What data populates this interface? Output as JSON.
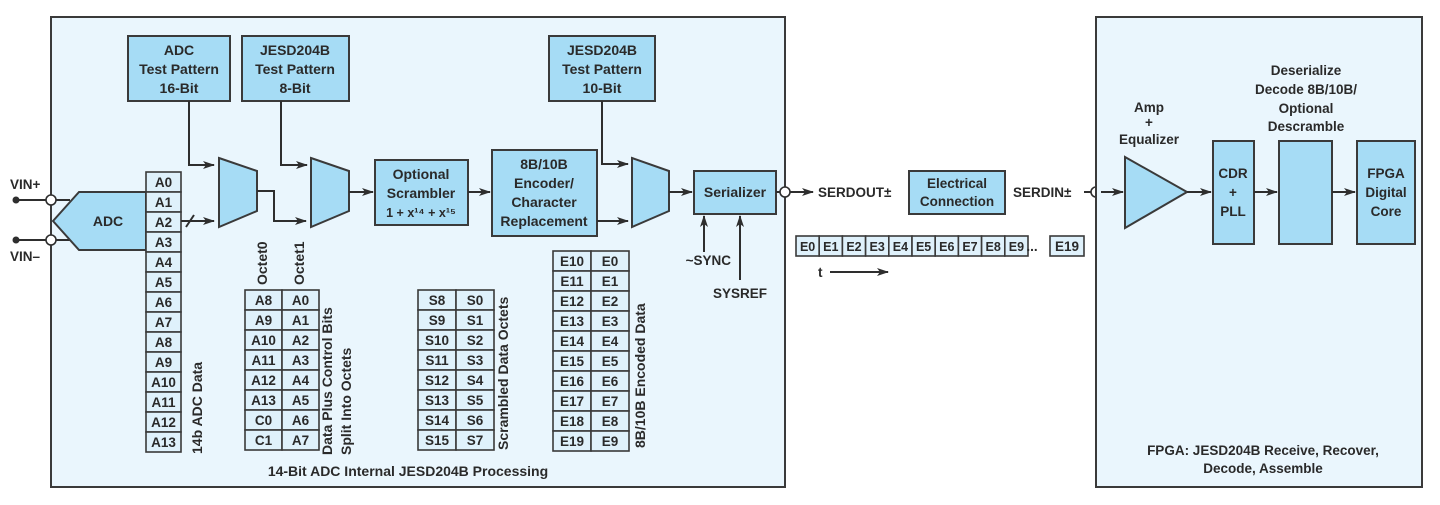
{
  "adc_panel": {
    "caption": "14-Bit ADC Internal JESD204B Processing",
    "inputs": [
      "VIN+",
      "VIN–"
    ],
    "adc_label": "ADC",
    "adc_test_pattern": [
      "ADC",
      "Test Pattern",
      "16-Bit"
    ],
    "jesd_test_pattern_8": [
      "JESD204B",
      "Test Pattern",
      "8-Bit"
    ],
    "jesd_test_pattern_10": [
      "JESD204B",
      "Test Pattern",
      "10-Bit"
    ],
    "scrambler": [
      "Optional",
      "Scrambler",
      "1 + x¹⁴ + x¹⁵"
    ],
    "encoder": [
      "8B/10B",
      "Encoder/",
      "Character",
      "Replacement"
    ],
    "serializer": "Serializer",
    "sync_label": "~SYNC",
    "sysref_label": "SYSREF",
    "octet_labels": [
      "Octet0",
      "Octet1"
    ],
    "adc_data": {
      "label": "14b ADC Data",
      "cells": [
        "A0",
        "A1",
        "A2",
        "A3",
        "A4",
        "A5",
        "A6",
        "A7",
        "A8",
        "A9",
        "A10",
        "A11",
        "A12",
        "A13"
      ]
    },
    "octets_table": {
      "label_lines": [
        "Data Plus Control Bits",
        "Split Into Octets"
      ],
      "rows": [
        [
          "A8",
          "A0"
        ],
        [
          "A9",
          "A1"
        ],
        [
          "A10",
          "A2"
        ],
        [
          "A11",
          "A3"
        ],
        [
          "A12",
          "A4"
        ],
        [
          "A13",
          "A5"
        ],
        [
          "C0",
          "A6"
        ],
        [
          "C1",
          "A7"
        ]
      ]
    },
    "scrambled_table": {
      "label": "Scrambled Data Octets",
      "rows": [
        [
          "S8",
          "S0"
        ],
        [
          "S9",
          "S1"
        ],
        [
          "S10",
          "S2"
        ],
        [
          "S11",
          "S3"
        ],
        [
          "S12",
          "S4"
        ],
        [
          "S13",
          "S5"
        ],
        [
          "S14",
          "S6"
        ],
        [
          "S15",
          "S7"
        ]
      ]
    },
    "encoded_table": {
      "label": "8B/10B Encoded Data",
      "rows": [
        [
          "E10",
          "E0"
        ],
        [
          "E11",
          "E1"
        ],
        [
          "E12",
          "E2"
        ],
        [
          "E13",
          "E3"
        ],
        [
          "E14",
          "E4"
        ],
        [
          "E15",
          "E5"
        ],
        [
          "E16",
          "E6"
        ],
        [
          "E17",
          "E7"
        ],
        [
          "E18",
          "E8"
        ],
        [
          "E19",
          "E9"
        ]
      ]
    }
  },
  "link": {
    "serdout": "SERDOUT±",
    "serdin": "SERDIN±",
    "connection": [
      "Electrical",
      "Connection"
    ],
    "stream": [
      "E0",
      "E1",
      "E2",
      "E3",
      "E4",
      "E5",
      "E6",
      "E7",
      "E8",
      "E9"
    ],
    "ellipsis": "...",
    "stream_last": "E19",
    "time_label": "t"
  },
  "fpga_panel": {
    "caption": [
      "FPGA: JESD204B Receive, Recover,",
      "Decode, Assemble"
    ],
    "amp_label": [
      "Amp",
      "+",
      "Equalizer"
    ],
    "cdr": [
      "CDR",
      "+",
      "PLL"
    ],
    "deserialize_label": [
      "Deserialize",
      "Decode 8B/10B/",
      "Optional",
      "Descramble"
    ],
    "core": [
      "FPGA",
      "Digital",
      "Core"
    ]
  },
  "colors": {
    "panel_fill": "#eaf6fd",
    "block_fill": "#a6dcf5",
    "cell_fill": "#dff1fb",
    "stroke": "#3a3a3a"
  }
}
